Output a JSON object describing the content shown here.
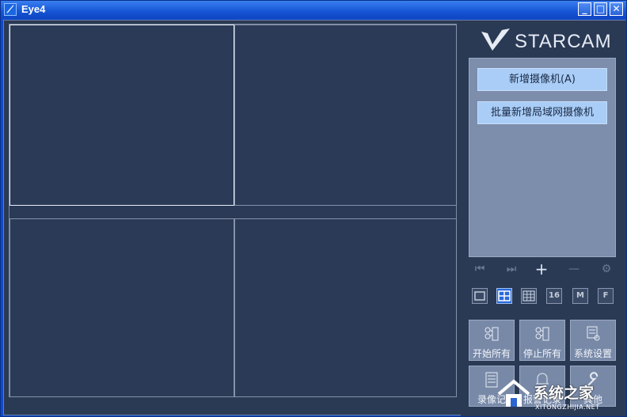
{
  "window": {
    "title": "Eye4",
    "controls": {
      "minimize": "_",
      "maximize": "□",
      "close": "✕"
    }
  },
  "logo": {
    "text": "STARCAM"
  },
  "camera_panel": {
    "add_camera": "新增摄像机(A)",
    "add_lan_cameras": "批量新增局域网摄像机"
  },
  "controls": {
    "first": "⏮",
    "next": "⏭",
    "add": "+",
    "remove": "—",
    "settings": "⚙"
  },
  "layouts": [
    {
      "id": "1",
      "label": ""
    },
    {
      "id": "4",
      "label": ""
    },
    {
      "id": "9",
      "label": ""
    },
    {
      "id": "16",
      "label": "16"
    },
    {
      "id": "M",
      "label": "M"
    },
    {
      "id": "F",
      "label": "F"
    }
  ],
  "functions": [
    {
      "label": "开始所有"
    },
    {
      "label": "停止所有"
    },
    {
      "label": "系统设置"
    },
    {
      "label": "录像记"
    },
    {
      "label": "报警记录"
    },
    {
      "label": "其他"
    }
  ],
  "watermark": {
    "text": "系统之家",
    "sub": "XITONGZHIJIA.NET"
  }
}
